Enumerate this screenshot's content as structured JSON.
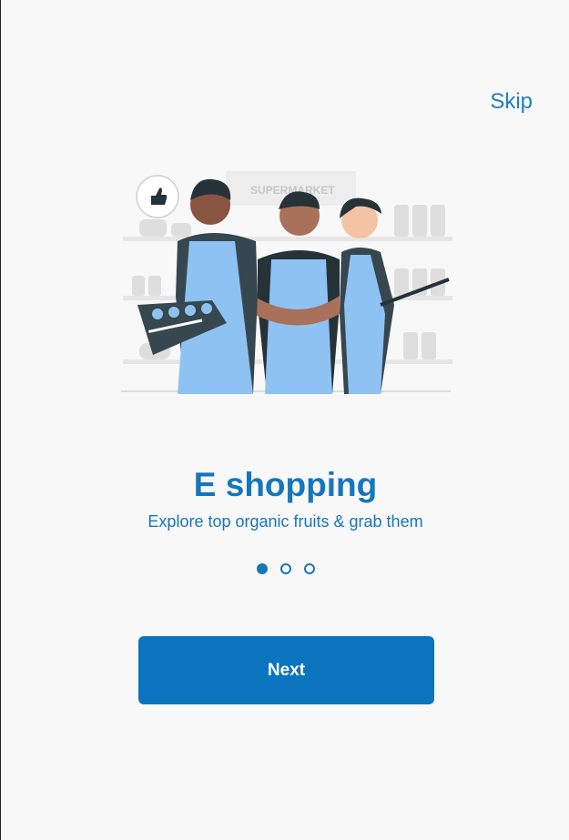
{
  "header": {
    "skip_label": "Skip"
  },
  "illustration": {
    "icon": "three-shop-workers-illustration",
    "sign_text": "SUPERMARKET",
    "badge_icon": "thumbs-up-icon"
  },
  "onboarding": {
    "title": "E shopping",
    "subtitle": "Explore top organic fruits & grab them",
    "page_count": 3,
    "active_page": 1
  },
  "footer": {
    "next_label": "Next"
  },
  "colors": {
    "accent": "#0a74bf",
    "background": "#f8f8f8",
    "apron": "#8ec2f2"
  }
}
